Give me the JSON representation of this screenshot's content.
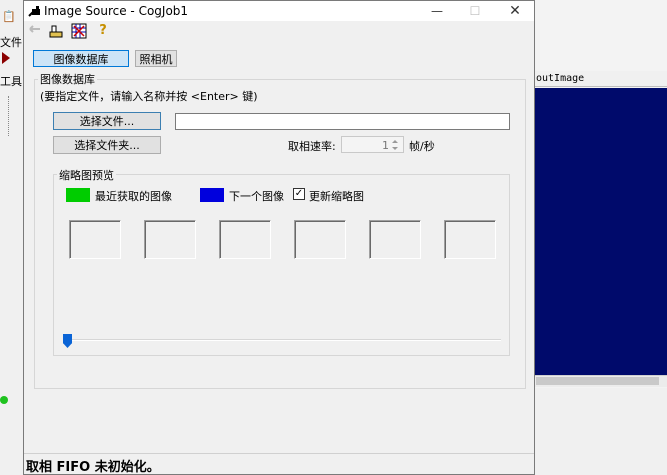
{
  "dialog": {
    "title": "Image Source - CogJob1",
    "window_buttons": {
      "minimize": "—",
      "maximize": "☐",
      "close": "✕"
    },
    "toolbar": [
      "arrow-icon",
      "camera-icon",
      "image-grid-icon",
      "help-icon"
    ],
    "tabs": [
      {
        "label": "图像数据库",
        "selected": true
      },
      {
        "label": "照相机",
        "selected": false
      }
    ],
    "section": {
      "title": "图像数据库",
      "hint": "(要指定文件，请输入名称并按 <Enter> 键)"
    },
    "select_file_label": "选择文件...",
    "select_folder_label": "选择文件夹...",
    "file_path_value": "",
    "frame_rate": {
      "label": "取相速率:",
      "value": "1",
      "unit": "帧/秒"
    },
    "thumbnails": {
      "title": "缩略图预览",
      "recent_label": "最近获取的图像",
      "next_label": "下一个图像",
      "update_label": "更新缩略图",
      "update_checked": true,
      "recent_color": "#00cc00",
      "next_color": "#0000dd",
      "count": 6
    },
    "status": "取相 FIFO 未初始化。"
  },
  "background": {
    "right_header": "outImage",
    "left_menu": "文件",
    "left_tool": "工具"
  }
}
